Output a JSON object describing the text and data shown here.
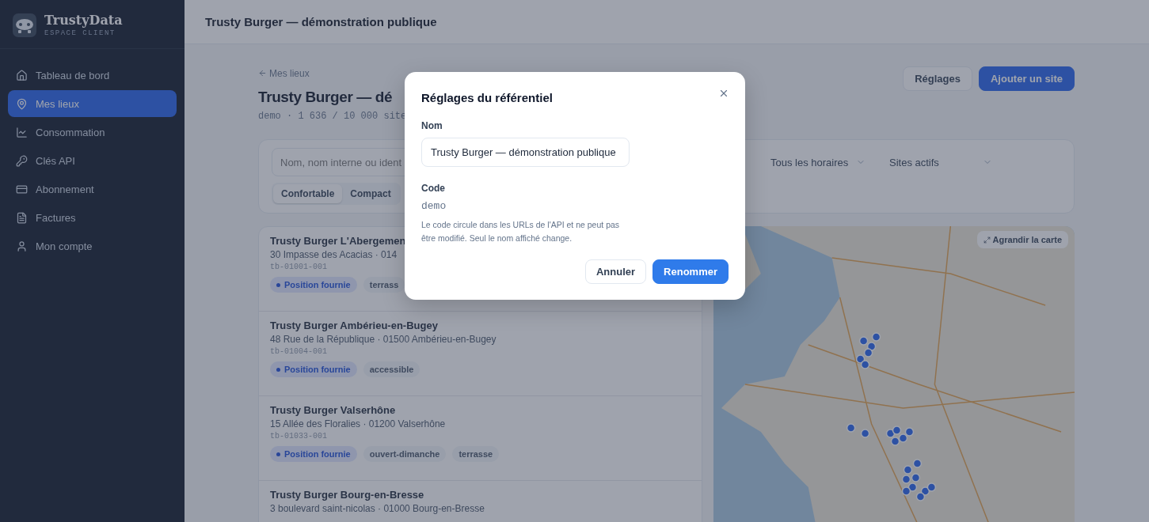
{
  "brand": {
    "name": "TrustyData",
    "subtitle": "ESPACE CLIENT"
  },
  "sidebar": {
    "items": [
      {
        "label": "Tableau de bord",
        "selected": false
      },
      {
        "label": "Mes lieux",
        "selected": true
      },
      {
        "label": "Consommation",
        "selected": false
      },
      {
        "label": "Clés API",
        "selected": false
      },
      {
        "label": "Abonnement",
        "selected": false
      },
      {
        "label": "Factures",
        "selected": false
      },
      {
        "label": "Mon compte",
        "selected": false
      }
    ]
  },
  "header": {
    "title": "Trusty Burger — démonstration publique"
  },
  "page": {
    "back_link": "Mes lieux",
    "title": "Trusty Burger — dé",
    "meta": "demo · 1 636 / 10 000 site",
    "buttons": [
      {
        "label": "Réglages",
        "kind": "secondary"
      },
      {
        "label": "Ajouter un site",
        "kind": "primary"
      }
    ]
  },
  "filters": {
    "search": {
      "placeholder": "Nom, nom interne ou ident"
    },
    "selects": [
      {
        "value": "Tous les horaires"
      },
      {
        "value": "Sites actifs"
      }
    ],
    "density": [
      {
        "label": "Confortable",
        "selected": true
      },
      {
        "label": "Compact",
        "selected": false
      }
    ]
  },
  "sites": [
    {
      "name": "Trusty Burger L'Abergemen",
      "address": "30 Impasse des Acacias · 014",
      "code": "tb-01001-001",
      "tags": [
        {
          "label": "Position fournie",
          "kind": "position"
        },
        {
          "label": "terrass",
          "kind": "plain"
        }
      ]
    },
    {
      "name": "Trusty Burger Ambérieu-en-Bugey",
      "address": "48 Rue de la République · 01500 Ambérieu-en-Bugey",
      "code": "tb-01004-001",
      "tags": [
        {
          "label": "Position fournie",
          "kind": "position"
        },
        {
          "label": "accessible",
          "kind": "plain"
        }
      ]
    },
    {
      "name": "Trusty Burger Valserhône",
      "address": "15 Allée des Floralies · 01200 Valserhône",
      "code": "tb-01033-001",
      "tags": [
        {
          "label": "Position fournie",
          "kind": "position"
        },
        {
          "label": "ouvert-dimanche",
          "kind": "plain"
        },
        {
          "label": "terrasse",
          "kind": "plain"
        }
      ]
    },
    {
      "name": "Trusty Burger Bourg-en-Bresse",
      "address": "3 boulevard saint-nicolas · 01000 Bourg-en-Bresse"
    }
  ],
  "map": {
    "button": "Agrandir la carte"
  },
  "dialog": {
    "title": "Réglages du référentiel",
    "name_label": "Nom",
    "name_value": "Trusty Burger — démonstration publique",
    "code_label": "Code",
    "code_value": "demo",
    "help": "Le code circule dans les URLs de l'API et ne peut pas être modifié. Seul le nom affiché change.",
    "buttons": [
      {
        "label": "Annuler",
        "kind": "secondary"
      },
      {
        "label": "Renommer",
        "kind": "primary"
      }
    ]
  }
}
